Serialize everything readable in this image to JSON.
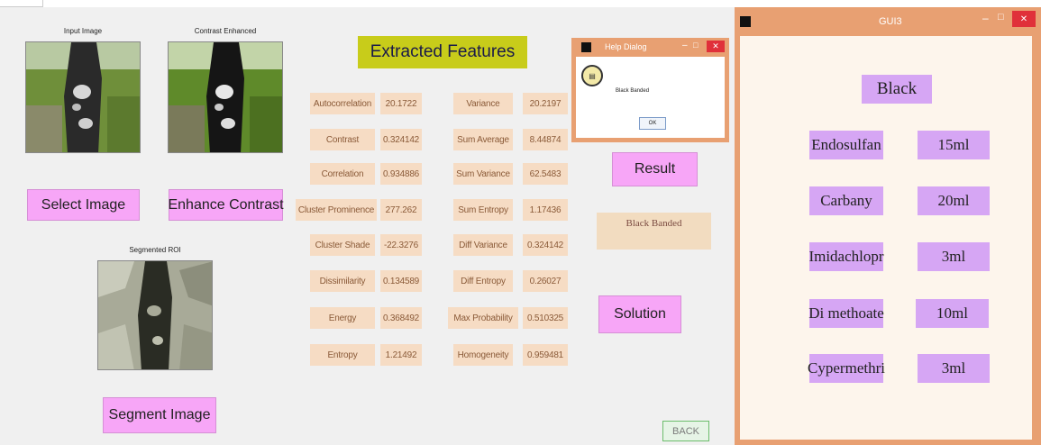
{
  "main": {
    "captions": {
      "input": "Input Image",
      "enhanced": "Contrast Enhanced",
      "segmented": "Segmented ROI"
    },
    "buttons": {
      "select": "Select Image",
      "enhance": "Enhance Contrast",
      "segment": "Segment Image",
      "result": "Result",
      "solution": "Solution",
      "back": "BACK"
    },
    "features_title": "Extracted Features",
    "features_left": [
      {
        "label": "Autocorrelation",
        "value": "20.1722"
      },
      {
        "label": "Contrast",
        "value": "0.324142"
      },
      {
        "label": "Correlation",
        "value": "0.934886"
      },
      {
        "label": "Cluster Prominence",
        "value": "277.262"
      },
      {
        "label": "Cluster Shade",
        "value": "-22.3276"
      },
      {
        "label": "Dissimilarity",
        "value": "0.134589"
      },
      {
        "label": "Energy",
        "value": "0.368492"
      },
      {
        "label": "Entropy",
        "value": "1.21492"
      }
    ],
    "features_right": [
      {
        "label": "Variance",
        "value": "20.2197"
      },
      {
        "label": "Sum Average",
        "value": "8.44874"
      },
      {
        "label": "Sum Variance",
        "value": "62.5483"
      },
      {
        "label": "Sum Entropy",
        "value": "1.17436"
      },
      {
        "label": "Diff Variance",
        "value": "0.324142"
      },
      {
        "label": "Diff Entropy",
        "value": "0.26027"
      },
      {
        "label": "Max Probability",
        "value": "0.510325"
      },
      {
        "label": "Homogeneity",
        "value": "0.959481"
      }
    ],
    "result_text": "Black Banded"
  },
  "help_dialog": {
    "title": "Help Dialog",
    "message": "Black Banded",
    "ok": "OK"
  },
  "gui3": {
    "title": "GUI3",
    "disease": "Black",
    "treatments": [
      {
        "name": "Endosulfan",
        "dose": "15ml"
      },
      {
        "name": "Carbany",
        "dose": "20ml"
      },
      {
        "name": "Imidachlopr",
        "dose": "3ml"
      },
      {
        "name": "Di methoate",
        "dose": "10ml"
      },
      {
        "name": "Cypermethri",
        "dose": "3ml"
      }
    ]
  },
  "colors": {
    "button_pink": "#f7a6f7",
    "feature_bg": "#f6dcc4",
    "title_yellow": "#c8cc1a",
    "window_frame": "#e8a072",
    "lavender": "#d6a6f4",
    "back_green": "#e6f4e6"
  },
  "icons": {
    "window_icon": "app-icon",
    "dialog_icon": "help-info-icon"
  }
}
